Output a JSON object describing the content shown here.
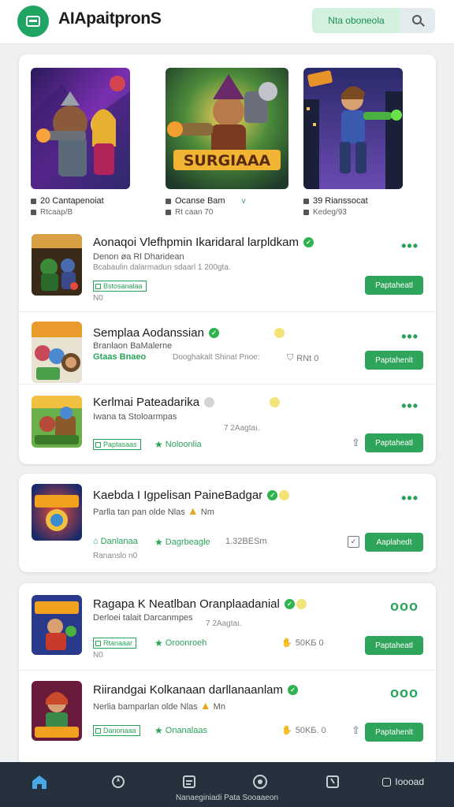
{
  "header": {
    "app_title": "ΑΙΑpaitpronS",
    "search_button_label": "Νta oboneola",
    "logo_icon": "app-logo-icon",
    "search_icon": "search-icon"
  },
  "featured": [
    {
      "line1": "20 Cantapenoiat",
      "line2": "Rtcaap/B",
      "palette": [
        "#2a1a5a",
        "#7a2fb0",
        "#e84a3a"
      ]
    },
    {
      "line1": "Ocanse Bam",
      "line2": "Rt caan 70",
      "title_art": "SURGIAAA",
      "mark": "v",
      "palette": [
        "#3a6a2a",
        "#f2b533",
        "#7a3a20"
      ]
    },
    {
      "line1": "39 Rianssocat",
      "line2": "Kedeg/93",
      "palette": [
        "#1a2a5a",
        "#3a5ab0",
        "#e8922a"
      ]
    }
  ],
  "games": [
    {
      "title": "Aonaqoi Vlefhpmin Ikaridaral larpldkam",
      "subtitle": "Denon øa Rl Dharidean",
      "sub2": "Bcabaulin dalarmadurı sdaarl  1  200gta.",
      "tag": "Bstosanalaa",
      "tag2": "N0",
      "button": "Paptaheatl"
    },
    {
      "title": "Semplaa Aodanssian",
      "subtitle": "Branlaon BaMalerne",
      "chip": "Gtaas Bnaeo",
      "sub2": "Dooghakalt Shinat Pnoe:",
      "meta": "RNt 0",
      "button": "Paptahenlt"
    },
    {
      "title": "Kerlmai Pateadarika",
      "subtitle": "Iwana ta Stoloarmpas",
      "sub2": "7  2Aagtaı.",
      "tag": "Paptasaas",
      "chip": "Noloonlia",
      "button": "Paptaheatl"
    },
    {
      "title": "Kaebda I Igpelisan PaineBadgar",
      "subtitle": "Parlla tan pan olde Nlas",
      "sub2_suffix": "Nm",
      "chip1": "Danlanaa",
      "chip2": "Dagrbeagle",
      "meta": "1.32BESm",
      "sub3": "Rananslo n0",
      "button": "Aaplahedt"
    },
    {
      "title": "Ragapa K Neatlban Oranplaadanial",
      "subtitle": "Derloei talait Darcanmpes",
      "sub2": "7  2Aagtaı.",
      "tag": "Rtanaaar",
      "chip": "Oroonroeh",
      "meta": "50KБ  0",
      "tag2": "N0",
      "button": "Paptaheatl"
    },
    {
      "title": "Riirandgai Kolkanaan darllanaanlam",
      "subtitle": "Nerlia bamparlan olde Nlas",
      "sub2_suffix": "Mn",
      "tag": "Danonaaa",
      "chip": "Onanalaas",
      "meta": "50KБ.  0",
      "button": "Paptahenlt"
    }
  ],
  "nav": {
    "items": [
      "home-icon",
      "explore-icon",
      "library-icon",
      "record-icon",
      "bookmark-icon"
    ],
    "caption": "Nanaeginiadi Pata Sooaaeon",
    "right_label": "Ioooad"
  },
  "colors": {
    "accent": "#2fa45b",
    "header_bg": "#ffffff",
    "nav_bg": "#25313c",
    "page_bg": "#eef0f2"
  }
}
